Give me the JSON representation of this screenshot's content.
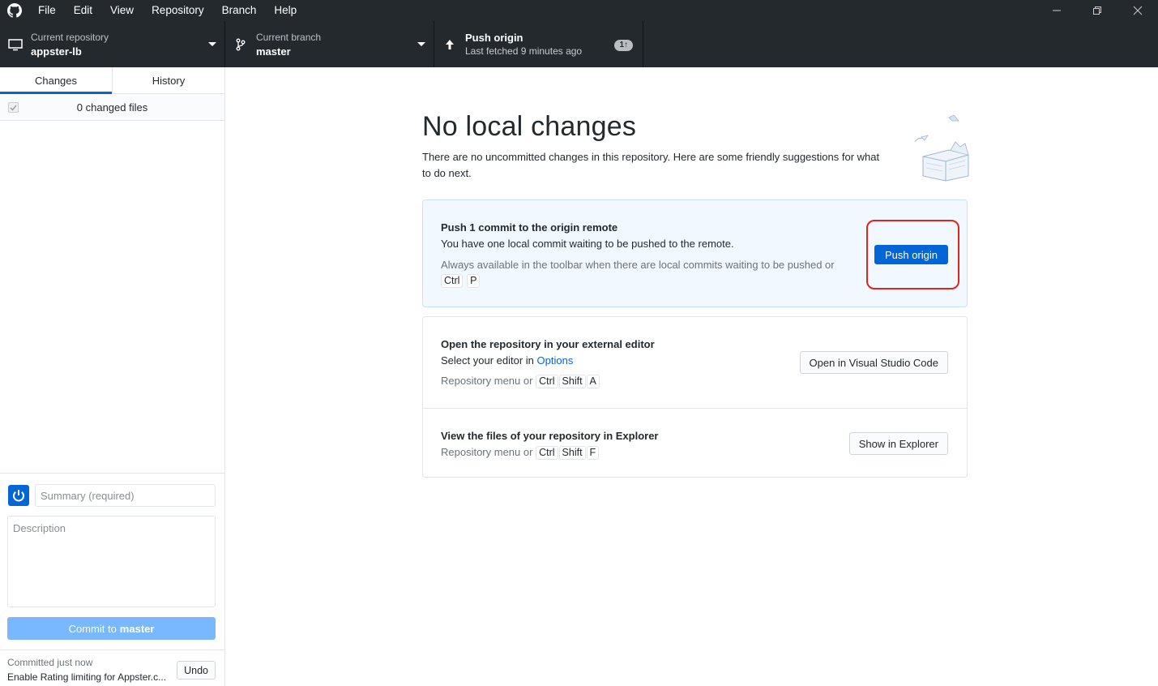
{
  "menu": [
    "File",
    "Edit",
    "View",
    "Repository",
    "Branch",
    "Help"
  ],
  "toolbar": {
    "repo_label": "Current repository",
    "repo_value": "appster-lb",
    "branch_label": "Current branch",
    "branch_value": "master",
    "push_label": "Push origin",
    "push_sub": "Last fetched 9 minutes ago",
    "push_badge": "1↑"
  },
  "sidebar": {
    "tabs": [
      "Changes",
      "History"
    ],
    "changed_files": "0 changed files",
    "summary_placeholder": "Summary (required)",
    "description_placeholder": "Description",
    "commit_prefix": "Commit to",
    "commit_branch": "master",
    "last_commit_time": "Committed just now",
    "last_commit_msg": "Enable Rating limiting for Appster.c...",
    "undo": "Undo"
  },
  "main": {
    "heading": "No local changes",
    "intro": "There are no uncommitted changes in this repository. Here are some friendly suggestions for what to do next.",
    "push_card": {
      "title": "Push 1 commit to the origin remote",
      "desc": "You have one local commit waiting to be pushed to the remote.",
      "hint": "Always available in the toolbar when there are local commits waiting to be pushed or",
      "keys": [
        "Ctrl",
        "P"
      ],
      "button": "Push origin"
    },
    "editor_card": {
      "title": "Open the repository in your external editor",
      "desc_prefix": "Select your editor in",
      "desc_link": "Options",
      "hint": "Repository menu or",
      "keys": [
        "Ctrl",
        "Shift",
        "A"
      ],
      "button": "Open in Visual Studio Code"
    },
    "explorer_card": {
      "title": "View the files of your repository in Explorer",
      "hint": "Repository menu or",
      "keys": [
        "Ctrl",
        "Shift",
        "F"
      ],
      "button": "Show in Explorer"
    }
  },
  "colors": {
    "titlebar": "#24292e",
    "accent": "#0366d6",
    "commit_button": "#79b8ff",
    "highlight": "#e0251b"
  }
}
